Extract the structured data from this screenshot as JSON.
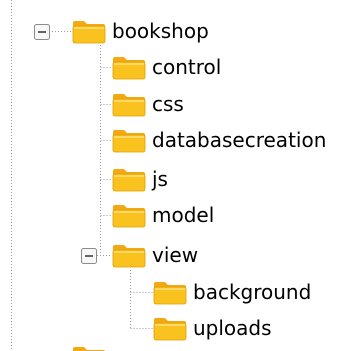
{
  "tree": {
    "root": {
      "label": "bookshop",
      "icon": "folder-icon",
      "expanded": true,
      "toggle_symbol": "minus",
      "children": [
        {
          "label": "control",
          "icon": "folder-icon"
        },
        {
          "label": "css",
          "icon": "folder-icon"
        },
        {
          "label": "databasecreation",
          "icon": "folder-icon"
        },
        {
          "label": "js",
          "icon": "folder-icon"
        },
        {
          "label": "model",
          "icon": "folder-icon"
        },
        {
          "label": "view",
          "icon": "folder-icon",
          "expanded": true,
          "toggle_symbol": "minus",
          "children": [
            {
              "label": "background",
              "icon": "folder-icon"
            },
            {
              "label": "uploads",
              "icon": "folder-icon"
            }
          ]
        }
      ]
    }
  },
  "colors": {
    "folder_body": "#F9C21F",
    "folder_tab": "#F3A814",
    "folder_edge": "#E0A000",
    "connector_dots": "#9A9A9A",
    "toggle_border": "#8C8C8C",
    "toggle_fill": "#F7F7F7",
    "toggle_sign": "#333333",
    "text": "#000000",
    "background": "#FFFFFF"
  }
}
